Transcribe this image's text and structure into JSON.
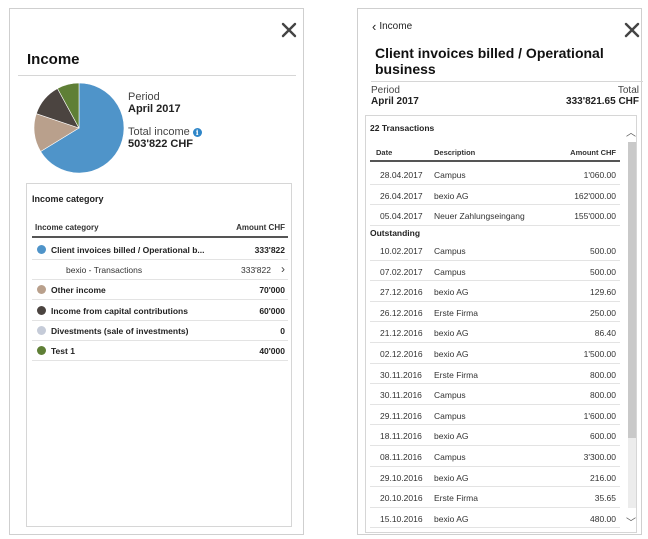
{
  "left": {
    "title": "Income",
    "period_label": "Period",
    "period_value": "April 2017",
    "total_label": "Total income",
    "total_value": "503'822 CHF",
    "pie": [
      {
        "name": "Client invoices billed / Operational business",
        "value": 333822,
        "color": "#4f94c9"
      },
      {
        "name": "Other income",
        "value": 70000,
        "color": "#b9a08c"
      },
      {
        "name": "Income from capital contributions",
        "value": 60000,
        "color": "#4b4440"
      },
      {
        "name": "Test 1",
        "value": 40000,
        "color": "#5f7f36"
      }
    ],
    "card": {
      "title": "Income category",
      "col_category": "Income category",
      "col_amount": "Amount CHF",
      "rows": [
        {
          "name": "Client invoices billed / Operational b...",
          "amount": "333'822",
          "color": "#4f94c9"
        },
        {
          "name": "bexio - Transactions",
          "amount": "333'822",
          "sub": true
        },
        {
          "name": "Other income",
          "amount": "70'000",
          "color": "#b9a08c"
        },
        {
          "name": "Income from capital contributions",
          "amount": "60'000",
          "color": "#4b4440"
        },
        {
          "name": "Divestments (sale of investments)",
          "amount": "0",
          "color": "#c5cbd8"
        },
        {
          "name": "Test 1",
          "amount": "40'000",
          "color": "#5f7f36"
        }
      ]
    }
  },
  "right": {
    "back_label": "Income",
    "title": "Client invoices billed / Operational business",
    "period_label": "Period",
    "period_value": "April 2017",
    "total_label": "Total",
    "total_value": "333'821.65 CHF",
    "count_label": "22 Transactions",
    "col_date": "Date",
    "col_description": "Description",
    "col_amount": "Amount CHF",
    "outstanding_label": "Outstanding",
    "transactions": [
      {
        "date": "28.04.2017",
        "desc": "Campus",
        "amount": "1'060.00"
      },
      {
        "date": "26.04.2017",
        "desc": "bexio AG",
        "amount": "162'000.00"
      },
      {
        "date": "05.04.2017",
        "desc": "Neuer Zahlungseingang",
        "amount": "155'000.00"
      }
    ],
    "outstanding": [
      {
        "date": "10.02.2017",
        "desc": "Campus",
        "amount": "500.00"
      },
      {
        "date": "07.02.2017",
        "desc": "Campus",
        "amount": "500.00"
      },
      {
        "date": "27.12.2016",
        "desc": "bexio AG",
        "amount": "129.60"
      },
      {
        "date": "26.12.2016",
        "desc": "Erste Firma",
        "amount": "250.00"
      },
      {
        "date": "21.12.2016",
        "desc": "bexio AG",
        "amount": "86.40"
      },
      {
        "date": "02.12.2016",
        "desc": "bexio AG",
        "amount": "1'500.00"
      },
      {
        "date": "30.11.2016",
        "desc": "Erste Firma",
        "amount": "800.00"
      },
      {
        "date": "30.11.2016",
        "desc": "Campus",
        "amount": "800.00"
      },
      {
        "date": "29.11.2016",
        "desc": "Campus",
        "amount": "1'600.00"
      },
      {
        "date": "18.11.2016",
        "desc": "bexio AG",
        "amount": "600.00"
      },
      {
        "date": "08.11.2016",
        "desc": "Campus",
        "amount": "3'300.00"
      },
      {
        "date": "29.10.2016",
        "desc": "bexio AG",
        "amount": "216.00"
      },
      {
        "date": "20.10.2016",
        "desc": "Erste Firma",
        "amount": "35.65"
      },
      {
        "date": "15.10.2016",
        "desc": "bexio AG",
        "amount": "480.00"
      }
    ]
  }
}
